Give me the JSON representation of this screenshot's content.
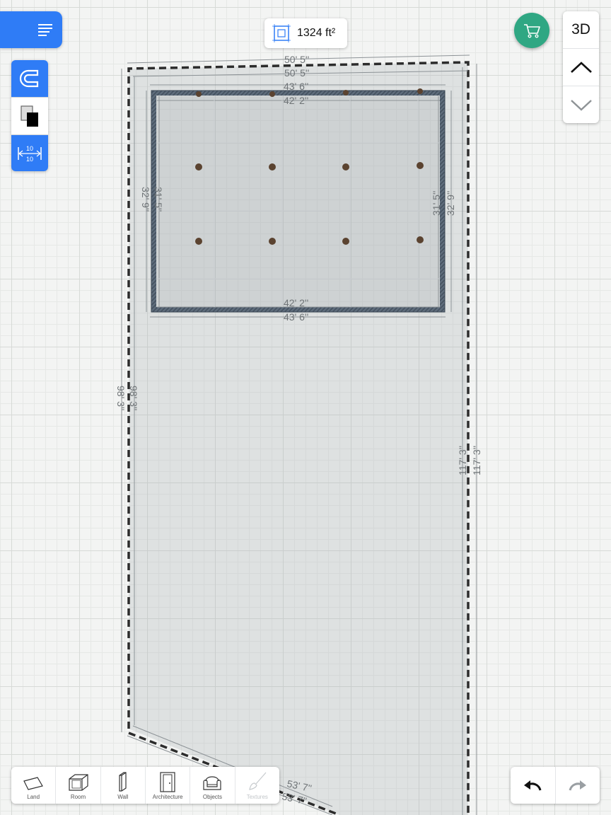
{
  "area_badge": {
    "value": "1324 ft²",
    "icon": "area-icon"
  },
  "view_controls": {
    "mode_label": "3D",
    "up_icon": "chevron-up-icon",
    "down_icon": "chevron-down-icon"
  },
  "left_tools": [
    {
      "name": "magnet-icon",
      "state": "active"
    },
    {
      "name": "layers-icon",
      "state": "inactive"
    },
    {
      "name": "measure-icon",
      "state": "active",
      "text_top": "10",
      "text_bottom": "10"
    }
  ],
  "dimensions": {
    "land_top_outer": "50' 5''",
    "land_top_inner": "50' 5''",
    "land_left_outer": "98' 3''",
    "land_left_inner": "98' 3''",
    "land_right_outer": "117' 3''",
    "land_right_inner": "117' 3''",
    "land_bottom_outer": "53' 7''",
    "land_bottom_inner": "53' 7''",
    "room_top_outer": "43' 6''",
    "room_top_inner": "42' 2''",
    "room_bottom_inner": "42' 2''",
    "room_bottom_outer": "43' 6''",
    "room_left_outer": "32' 9''",
    "room_left_inner": "31' 5''",
    "room_right_inner": "31' 5''",
    "room_right_outer": "32' 9''"
  },
  "bottom_toolbar": [
    {
      "label": "Land",
      "icon": "land-icon",
      "enabled": true
    },
    {
      "label": "Room",
      "icon": "room-icon",
      "enabled": true
    },
    {
      "label": "Wall",
      "icon": "wall-icon",
      "enabled": true
    },
    {
      "label": "Architecture",
      "icon": "door-icon",
      "enabled": true
    },
    {
      "label": "Objects",
      "icon": "armchair-icon",
      "enabled": true
    },
    {
      "label": "Textures",
      "icon": "brush-icon",
      "enabled": false
    }
  ],
  "colors": {
    "accent": "#2f7cf6",
    "cart": "#2fa783",
    "wall": "#4b5a6b",
    "post": "#5b4330"
  }
}
